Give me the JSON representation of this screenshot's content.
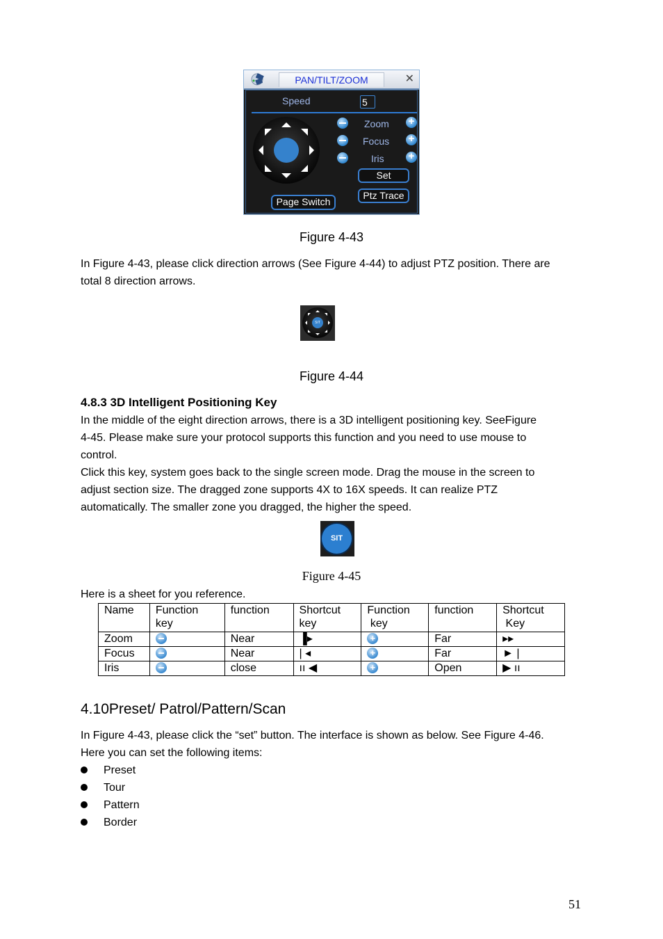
{
  "ptz_dialog": {
    "title": "PAN/TILT/ZOOM",
    "close_glyph": "✕",
    "speed_label": "Speed",
    "speed_value": "5",
    "zoom_label": "Zoom",
    "focus_label": "Focus",
    "iris_label": "Iris",
    "set_label": "Set",
    "ptz_trace_label": "Ptz Trace",
    "page_switch_label": "Page Switch",
    "accent_color": "#3582cc",
    "title_color": "#1b2fd6"
  },
  "figure_43_caption": "Figure 4-43",
  "para_1": "In Figure 4-43, please click direction arrows (See Figure 4-44) to adjust PTZ position. There are",
  "para_1b": "total 8 direction arrows.",
  "figure_44_label": "SIT",
  "figure_44_caption": "Figure 4-44",
  "section_483": {
    "heading": "4.8.3 3D Intelligent Positioning Key",
    "lines": [
      "In the middle of the eight direction arrows, there is a 3D intelligent positioning key. SeeFigure",
      "4-45. Please make sure your protocol supports this function and you need to use mouse to",
      "control.",
      "Click this key, system goes back to the single screen mode. Drag the mouse in the screen to",
      "adjust section size.  The dragged zone supports 4X to 16X speeds. It can realize PTZ",
      "automatically. The smaller zone you dragged, the higher the speed."
    ]
  },
  "figure_45_label": "SIT",
  "figure_45_caption": "Figure 4-45",
  "sheet_intro": "Here is a sheet for you reference.",
  "table": {
    "headers": [
      [
        "Name",
        ""
      ],
      [
        "Function",
        "key"
      ],
      [
        "function",
        ""
      ],
      [
        "Shortcut",
        "key"
      ],
      [
        "Function",
        " key"
      ],
      [
        "function",
        ""
      ],
      [
        "Shortcut",
        " Key"
      ]
    ],
    "rows": [
      {
        "name": "Zoom",
        "minus_icon": "minus-icon",
        "near": "Near",
        "short_near": "▐▸",
        "plus_icon": "plus-icon",
        "far": "Far",
        "short_far": "▸▸"
      },
      {
        "name": "Focus",
        "minus_icon": "minus-icon",
        "near": "Near",
        "short_near": "| ◂",
        "plus_icon": "plus-icon",
        "far": "Far",
        "short_far": "► |"
      },
      {
        "name": "Iris",
        "minus_icon": "minus-icon",
        "near": "close",
        "short_near": "ıı ◀",
        "plus_icon": "plus-icon",
        "far": "Open",
        "short_far": "▶ ıı"
      }
    ]
  },
  "section_410": {
    "heading": "4.10 Preset/ Patrol/Pattern/Scan",
    "heading_num": "4.10",
    "heading_text": "Preset/ Patrol/Pattern/Scan",
    "line_1": "In Figure 4-43, please click the “set” button. The interface is shown as below. See Figure 4-46.",
    "line_2": "Here you can set the following items:",
    "bullets": [
      "Preset",
      "Tour",
      "Pattern",
      "Border"
    ]
  },
  "page_number": "51"
}
